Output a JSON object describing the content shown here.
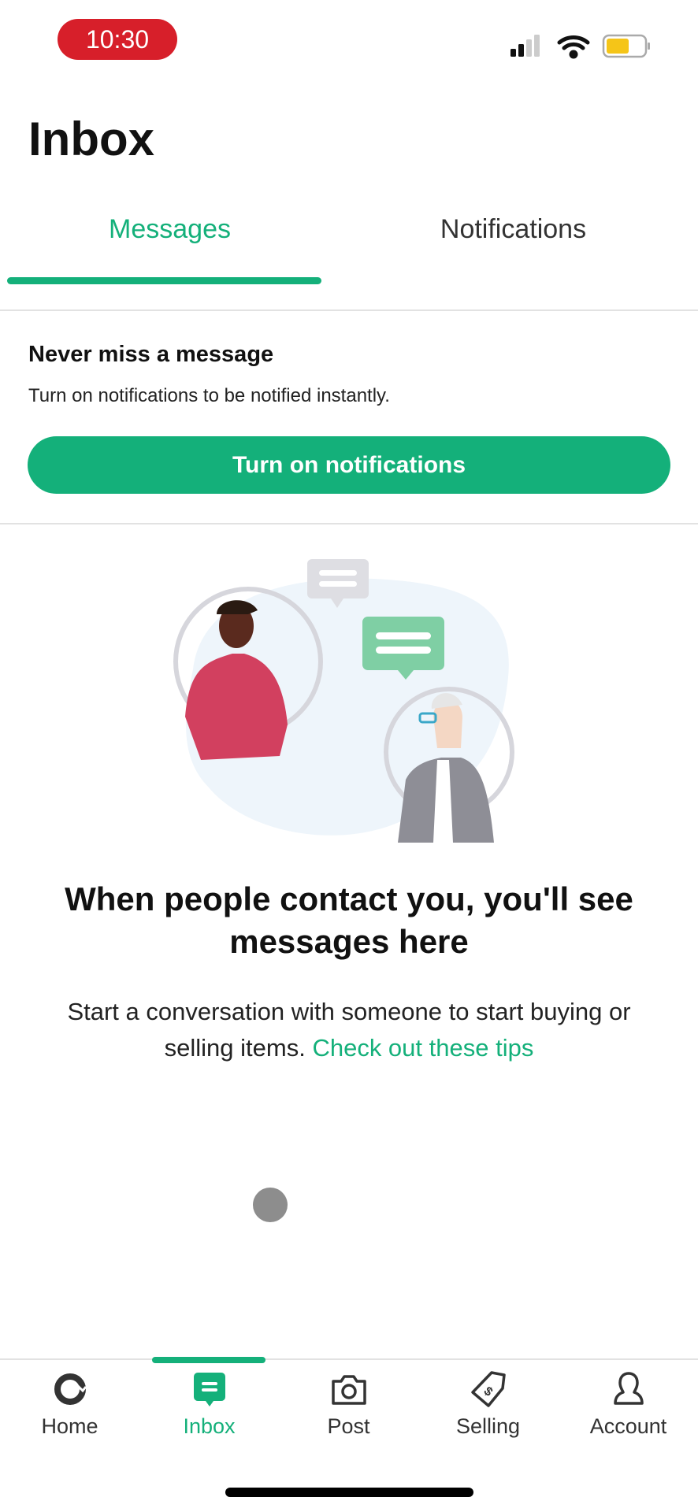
{
  "status_bar": {
    "time": "10:30",
    "battery_color": "#f5c518",
    "signal": "2 of 4 bars"
  },
  "header": {
    "title": "Inbox"
  },
  "tabs": [
    {
      "label": "Messages",
      "active": true
    },
    {
      "label": "Notifications",
      "active": false
    }
  ],
  "banner": {
    "title": "Never miss a message",
    "subtitle": "Turn on notifications to be notified instantly.",
    "button": "Turn on notifications"
  },
  "empty_state": {
    "heading": "When people contact you, you'll see messages here",
    "body": "Start a conversation with someone to start buying or selling items.",
    "link": "Check out these tips"
  },
  "bottom_nav": [
    {
      "label": "Home",
      "icon": "home-ring-icon"
    },
    {
      "label": "Inbox",
      "icon": "chat-icon",
      "active": true
    },
    {
      "label": "Post",
      "icon": "camera-icon"
    },
    {
      "label": "Selling",
      "icon": "price-tag-icon"
    },
    {
      "label": "Account",
      "icon": "person-icon"
    }
  ],
  "colors": {
    "accent": "#14b07a",
    "time_pill": "#d71f2a"
  }
}
